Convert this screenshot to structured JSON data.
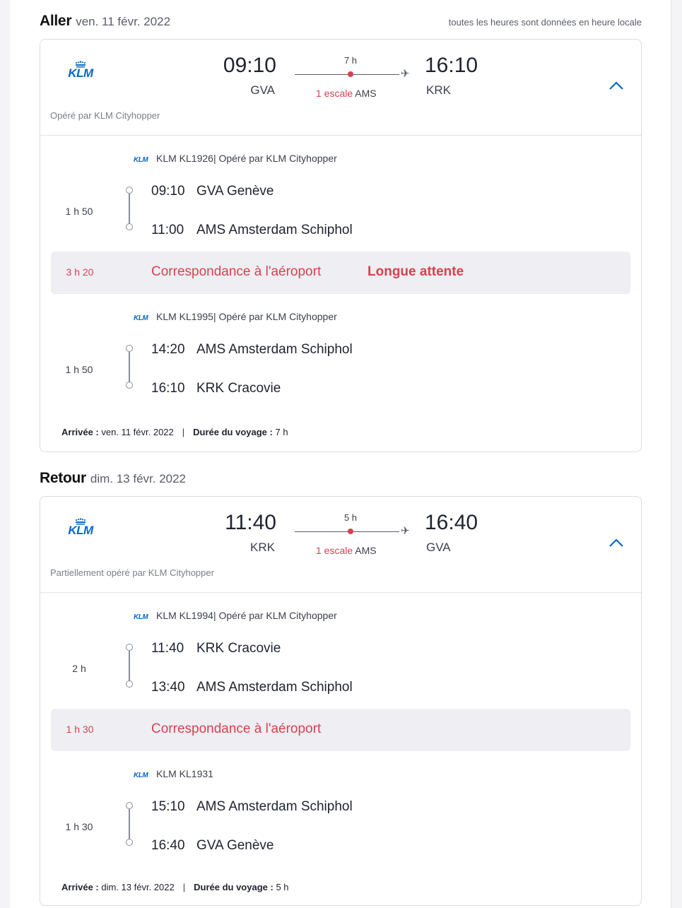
{
  "outbound": {
    "title": "Aller",
    "date": "ven. 11 févr. 2022",
    "note": "toutes les heures sont données en heure locale",
    "airline_logo": "KLM",
    "operated": "Opéré par KLM Cityhopper",
    "dep_time": "09:10",
    "dep_code": "GVA",
    "arr_time": "16:10",
    "arr_code": "KRK",
    "duration": "7 h",
    "stops_label": "1 escale",
    "stops_airport": "AMS",
    "segments": [
      {
        "flight": "KLM KL1926| Opéré par KLM Cityhopper",
        "duration": "1 h 50",
        "from_time": "09:10",
        "from_place": "GVA Genève",
        "to_time": "11:00",
        "to_place": "AMS Amsterdam Schiphol"
      },
      {
        "flight": "KLM KL1995| Opéré par KLM Cityhopper",
        "duration": "1 h 50",
        "from_time": "14:20",
        "from_place": "AMS Amsterdam Schiphol",
        "to_time": "16:10",
        "to_place": "KRK Cracovie"
      }
    ],
    "connection": {
      "duration": "3 h 20",
      "label": "Correspondance à l'aéroport",
      "warning": "Longue attente"
    },
    "footer": {
      "arrival_label": "Arrivée :",
      "arrival_value": "ven. 11 févr. 2022",
      "sep": "|",
      "trip_label": "Durée du voyage :",
      "trip_value": "7 h"
    }
  },
  "return": {
    "title": "Retour",
    "date": "dim. 13 févr. 2022",
    "airline_logo": "KLM",
    "operated": "Partiellement opéré par KLM Cityhopper",
    "dep_time": "11:40",
    "dep_code": "KRK",
    "arr_time": "16:40",
    "arr_code": "GVA",
    "duration": "5 h",
    "stops_label": "1 escale",
    "stops_airport": "AMS",
    "segments": [
      {
        "flight": "KLM KL1994| Opéré par KLM Cityhopper",
        "duration": "2 h",
        "from_time": "11:40",
        "from_place": "KRK Cracovie",
        "to_time": "13:40",
        "to_place": "AMS Amsterdam Schiphol"
      },
      {
        "flight": "KLM KL1931",
        "duration": "1 h 30",
        "from_time": "15:10",
        "from_place": "AMS Amsterdam Schiphol",
        "to_time": "16:40",
        "to_place": "GVA Genève"
      }
    ],
    "connection": {
      "duration": "1 h 30",
      "label": "Correspondance à l'aéroport"
    },
    "footer": {
      "arrival_label": "Arrivée :",
      "arrival_value": "dim. 13 févr. 2022",
      "sep": "|",
      "trip_label": "Durée du voyage :",
      "trip_value": "5 h"
    }
  },
  "colors": {
    "accent": "#0a67c4",
    "alert": "#d6424f",
    "connection_bg": "#eeeef3"
  },
  "icons": {
    "airline": "klm-logo",
    "expand": "chevron-up-icon",
    "plane": "plane-icon"
  }
}
